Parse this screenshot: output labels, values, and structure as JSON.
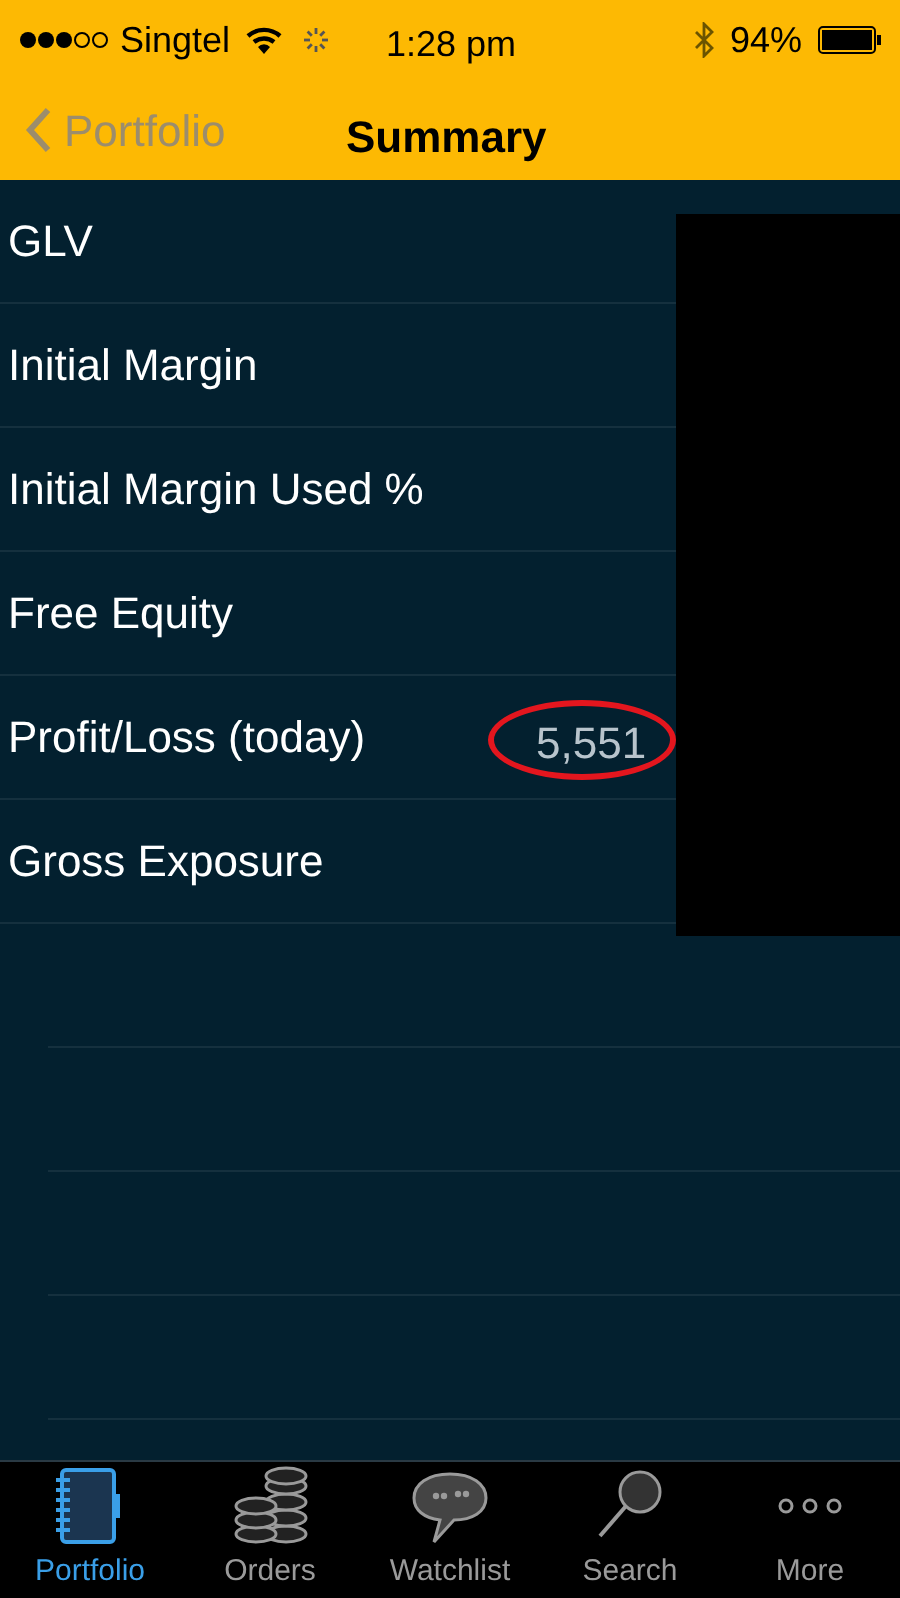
{
  "status_bar": {
    "carrier": "Singtel",
    "time": "1:28 pm",
    "battery": "94%"
  },
  "nav_bar": {
    "back": "Portfolio",
    "title": "Summary"
  },
  "rows": [
    {
      "label": "GLV"
    },
    {
      "label": "Initial Margin"
    },
    {
      "label": "Initial Margin Used %"
    },
    {
      "label": "Free Equity"
    },
    {
      "label": "Profit/Loss (today)",
      "value": "5,551",
      "circled": true
    },
    {
      "label": "Gross Exposure"
    }
  ],
  "tabs": [
    {
      "label": "Portfolio",
      "selected": true,
      "kind": "notebook"
    },
    {
      "label": "Orders",
      "selected": false,
      "kind": "coins"
    },
    {
      "label": "Watchlist",
      "selected": false,
      "kind": "speech"
    },
    {
      "label": "Search",
      "selected": false,
      "kind": "search"
    },
    {
      "label": "More",
      "selected": false,
      "kind": "more"
    }
  ]
}
